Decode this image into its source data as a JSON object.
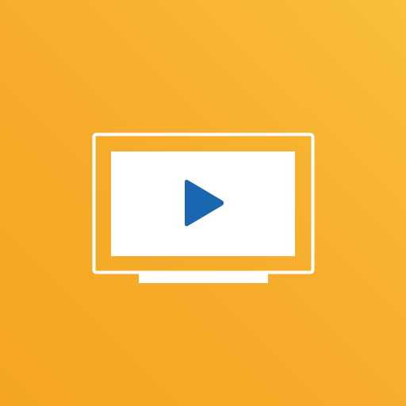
{
  "app_icon": {
    "icon": "tv-play-icon",
    "colors": {
      "background_light": "#f9be3a",
      "background_dark": "#f3a523",
      "tv_outline": "#ffffff",
      "screen": "#ffffff",
      "play": "#1a67b1"
    }
  }
}
